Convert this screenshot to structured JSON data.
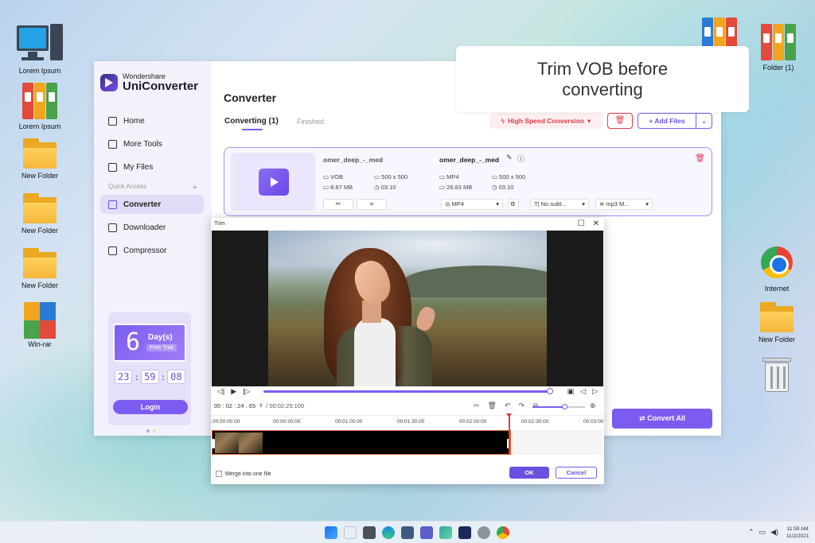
{
  "desktop": {
    "left_icons": [
      {
        "label": "Lorem Ipsum",
        "type": "computer"
      },
      {
        "label": "Lorem Ipsum",
        "type": "binders"
      },
      {
        "label": "New Folder",
        "type": "folder"
      },
      {
        "label": "New Folder",
        "type": "folder"
      },
      {
        "label": "New Folder",
        "type": "folder"
      },
      {
        "label": "Win-rar",
        "type": "winrar"
      }
    ],
    "right_icons": [
      {
        "label": "Folder (1)",
        "type": "binders"
      },
      {
        "label": "Internet",
        "type": "chrome"
      },
      {
        "label": "New Folder",
        "type": "folder"
      },
      {
        "label": "",
        "type": "recycle-bin"
      }
    ]
  },
  "callout": {
    "line1": "Trim VOB before",
    "line2": "converting"
  },
  "app": {
    "brand_top": "Wondershare",
    "brand_name": "UniConverter",
    "nav": [
      {
        "label": "Home",
        "icon": "home-icon"
      },
      {
        "label": "More Tools",
        "icon": "tools-icon"
      },
      {
        "label": "My Files",
        "icon": "files-icon"
      },
      {
        "label": "Converter",
        "icon": "converter-icon",
        "active": true
      },
      {
        "label": "Downloader",
        "icon": "downloader-icon"
      },
      {
        "label": "Compressor",
        "icon": "compressor-icon"
      }
    ],
    "quick_access": "Quick Access",
    "quick_access_add": "+",
    "promo": {
      "digit": "6",
      "days": "Day(s)",
      "free_trial": "Free Trial",
      "timer": [
        "23",
        "59",
        "08"
      ],
      "login": "Login"
    },
    "page_title": "Converter",
    "tabs": {
      "converting": "Converting (1)",
      "finished": "Finished"
    },
    "high_speed": "High Speed Conversion",
    "add_files": "Add Files",
    "file": {
      "src_name": "omer_deep_-_med",
      "src_format": "VOB",
      "src_size": "8.87 MB",
      "src_res": "500 x 500",
      "src_duration": "03:10",
      "out_name": "omer_deep_-_med",
      "out_format": "MP4",
      "out_size": "26.83 MB",
      "out_res": "500 x 500",
      "out_duration": "03:10",
      "format_select": "MP4",
      "subtitle_select": "No subt...",
      "audio_select": "mp3 M..."
    },
    "convert_all": "Convert All"
  },
  "trim": {
    "title": "Trim",
    "current_time": "00 : 02 : 24 . 65",
    "total_time": "/ 00:02:25:100",
    "progress": 0.99,
    "zoom_level": 0.6,
    "ruler": [
      "00:00:00:00",
      "00:00:30:00",
      "00:01:00:00",
      "00:01:30:00",
      "00:02:00:00",
      "00:02:30:00",
      "00:03:00"
    ],
    "merge_label": "Merge into one file",
    "ok": "OK",
    "cancel": "Cancel"
  },
  "taskbar": {
    "time": "11:59 AM",
    "date": "11/2/2021"
  },
  "colors": {
    "accent": "#7c5cf0",
    "danger": "#e03b4b"
  }
}
